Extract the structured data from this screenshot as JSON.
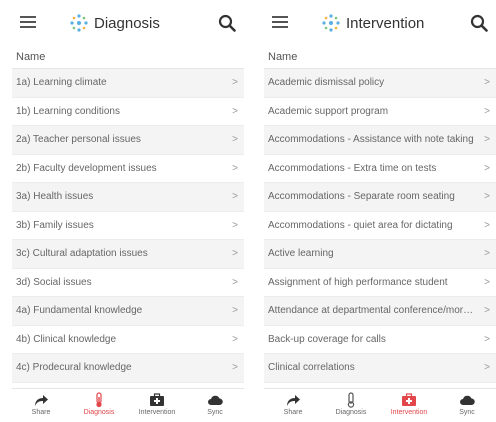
{
  "colors": {
    "accent": "#e2474b",
    "icon": "#333333",
    "row_alt": "#f4f4f4"
  },
  "screens": [
    {
      "title": "Diagnosis",
      "column_header": "Name",
      "items": [
        "1a) Learning climate",
        "1b) Learning conditions",
        "2a) Teacher personal issues",
        "2b) Faculty development issues",
        "3a) Health issues",
        "3b) Family issues",
        "3c) Cultural adaptation issues",
        "3d) Social issues",
        "4a) Fundamental knowledge",
        "4b) Clinical knowledge",
        "4c) Prodecural knowledge"
      ],
      "active_tab": "Diagnosis"
    },
    {
      "title": "Intervention",
      "column_header": "Name",
      "items": [
        "Academic dismissal policy",
        "Academic support program",
        "Accommodations - Assistance with note taking",
        "Accommodations - Extra time on tests",
        "Accommodations - Separate room seating",
        "Accommodations - quiet area for dictating",
        "Active learning",
        "Assignment of high performance student",
        "Attendance at departmental conference/morni...",
        "Back-up coverage for calls",
        "Clinical correlations"
      ],
      "active_tab": "Intervention"
    }
  ],
  "footer_tabs": [
    {
      "label": "Share",
      "icon": "share-arrow-icon"
    },
    {
      "label": "Diagnosis",
      "icon": "thermometer-icon"
    },
    {
      "label": "Intervention",
      "icon": "medical-kit-icon"
    },
    {
      "label": "Sync",
      "icon": "cloud-icon"
    }
  ],
  "row_chevron": ">"
}
